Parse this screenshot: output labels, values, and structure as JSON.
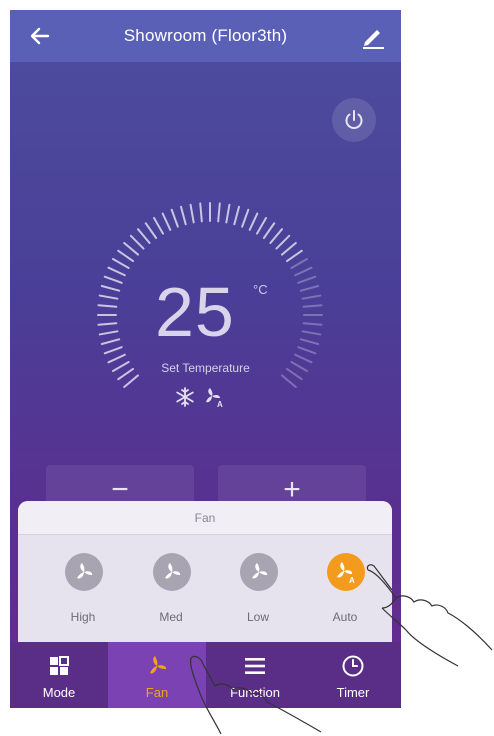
{
  "header": {
    "title": "Showroom (Floor3th)",
    "back_icon": "arrow-left-icon",
    "edit_icon": "pencil-icon"
  },
  "power": {
    "icon": "power-icon"
  },
  "temperature": {
    "value": "25",
    "unit": "°C",
    "label": "Set Temperature",
    "mode_icons": [
      "snowflake-icon",
      "fan-auto-icon"
    ]
  },
  "adjust": {
    "minus": "−",
    "plus": "+"
  },
  "fan_panel": {
    "title": "Fan",
    "options": [
      {
        "label": "High",
        "active": false
      },
      {
        "label": "Med",
        "active": false
      },
      {
        "label": "Low",
        "active": false
      },
      {
        "label": "Auto",
        "active": true
      }
    ]
  },
  "bottom_nav": {
    "items": [
      {
        "label": "Mode",
        "icon": "mode-grid-icon",
        "active": false
      },
      {
        "label": "Fan",
        "icon": "fan-icon",
        "active": true
      },
      {
        "label": "Function",
        "icon": "menu-lines-icon",
        "active": false
      },
      {
        "label": "Timer",
        "icon": "clock-icon",
        "active": false
      }
    ]
  },
  "colors": {
    "header": "#5b60b7",
    "accent": "#f39b1d",
    "nav_bg": "#5a2d86",
    "nav_active": "#7a42b3"
  }
}
